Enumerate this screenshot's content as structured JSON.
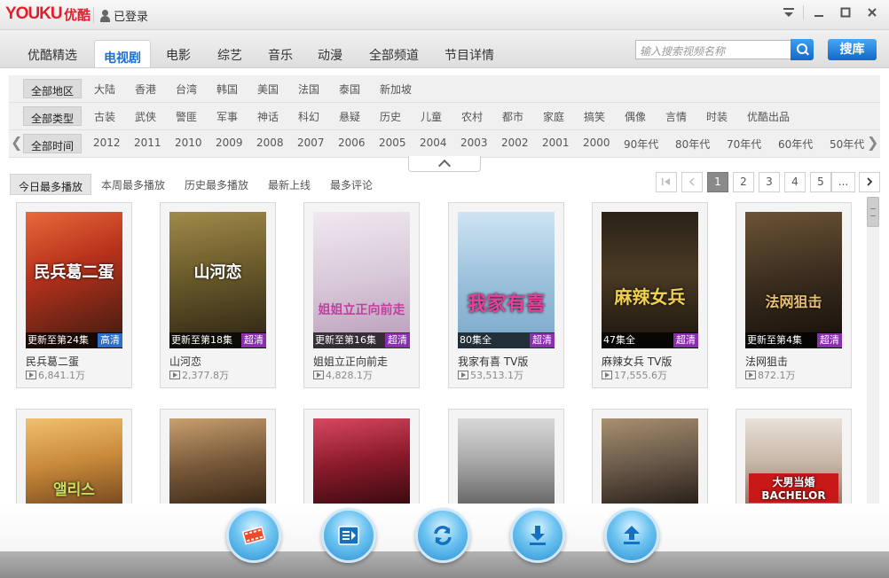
{
  "app": {
    "logo_latin": "YOUKU",
    "logo_cn": "优酷",
    "user_status": "已登录"
  },
  "nav": {
    "tabs": [
      {
        "label": "优酷精选"
      },
      {
        "label": "电视剧"
      },
      {
        "label": "电影"
      },
      {
        "label": "综艺"
      },
      {
        "label": "音乐"
      },
      {
        "label": "动漫"
      },
      {
        "label": "全部频道"
      },
      {
        "label": "节目详情"
      }
    ],
    "active": "电视剧",
    "search_placeholder": "输入搜索视频名称",
    "search_button": "搜库"
  },
  "filters": {
    "region": [
      "全部地区",
      "大陆",
      "香港",
      "台湾",
      "韩国",
      "美国",
      "法国",
      "泰国",
      "新加坡"
    ],
    "genre": [
      "全部类型",
      "古装",
      "武侠",
      "警匪",
      "军事",
      "神话",
      "科幻",
      "悬疑",
      "历史",
      "儿童",
      "农村",
      "都市",
      "家庭",
      "搞笑",
      "偶像",
      "言情",
      "时装",
      "优酷出品"
    ],
    "time": [
      "全部时间",
      "2012",
      "2011",
      "2010",
      "2009",
      "2008",
      "2007",
      "2006",
      "2005",
      "2004",
      "2003",
      "2002",
      "2001",
      "2000",
      "90年代",
      "80年代",
      "70年代",
      "60年代",
      "50年代"
    ]
  },
  "sort_tabs": [
    "今日最多播放",
    "本周最多播放",
    "历史最多播放",
    "最新上线",
    "最多评论"
  ],
  "pagination": {
    "pages": [
      "1",
      "2",
      "3",
      "4",
      "5",
      "..."
    ],
    "current": "1"
  },
  "cards": [
    {
      "title": "民兵葛二蛋",
      "plays": "6,841.1万",
      "update": "更新至第24集",
      "quality": "高清",
      "quality_color": "#2a6fd0",
      "poster_text": "民兵葛二蛋",
      "bg": "#b8321c"
    },
    {
      "title": "山河恋",
      "plays": "2,377.8万",
      "update": "更新至第18集",
      "quality": "超清",
      "quality_color": "#8a2fb0",
      "poster_text": "山河恋",
      "bg": "#6a5a2a"
    },
    {
      "title": "姐姐立正向前走",
      "plays": "4,828.1万",
      "update": "更新至第16集",
      "quality": "超清",
      "quality_color": "#8a2fb0",
      "poster_text": "姐姐立正向前走",
      "bg": "#d8c8d8"
    },
    {
      "title": "我家有喜 TV版",
      "plays": "53,513.1万",
      "update": "80集全",
      "quality": "超清",
      "quality_color": "#8a2fb0",
      "poster_text": "我家有喜",
      "bg": "#9bc1dc"
    },
    {
      "title": "麻辣女兵 TV版",
      "plays": "17,555.6万",
      "update": "47集全",
      "quality": "超清",
      "quality_color": "#8a2fb0",
      "poster_text": "麻辣女兵",
      "bg": "#4a3a24"
    },
    {
      "title": "法网狙击",
      "plays": "872.1万",
      "update": "更新至第4集",
      "quality": "超清",
      "quality_color": "#8a2fb0",
      "poster_text": "法网狙击",
      "bg": "#3a2c1e"
    },
    {
      "poster_text": "앨리스",
      "bg": "#c88a3a"
    },
    {
      "poster_text": "",
      "bg": "#7a5a3a"
    },
    {
      "poster_text": "",
      "bg": "#8a1a2a"
    },
    {
      "poster_text": "",
      "bg": "#a8a8a8"
    },
    {
      "poster_text": "",
      "bg": "#6a5a4a"
    },
    {
      "poster_text": "大男当婚 BACHELOR",
      "bg": "#c8b8a8"
    }
  ],
  "dock": [
    {
      "icon": "film-icon"
    },
    {
      "icon": "playlist-icon"
    },
    {
      "icon": "refresh-icon"
    },
    {
      "icon": "download-icon"
    },
    {
      "icon": "upload-icon"
    }
  ]
}
